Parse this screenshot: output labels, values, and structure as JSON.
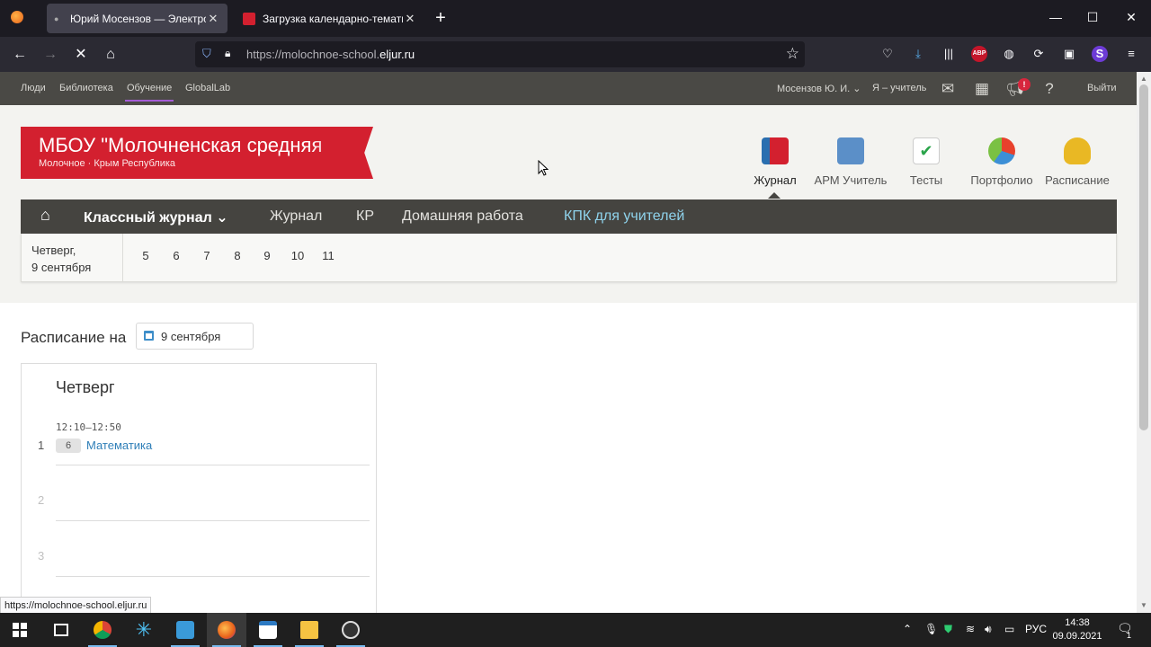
{
  "browser": {
    "tabs": [
      {
        "title": "Юрий Мосензов — Электронн",
        "active": true
      },
      {
        "title": "Загрузка календарно-тематич",
        "active": false
      }
    ],
    "new_tab": "+",
    "window_controls": {
      "minimize": "—",
      "maximize": "☐",
      "close": "✕"
    },
    "url_prefix": "https://molochnoe-school.",
    "url_domain": "eljur.ru",
    "status_url": "https://molochnoe-school.eljur.ru",
    "toolbar_icons": [
      "pocket-icon",
      "download-icon",
      "library-icon",
      "adblock-icon",
      "globe-icon",
      "sync-icon",
      "screenshot-icon",
      "extension-icon",
      "menu-icon"
    ],
    "adblock_label": "ABP"
  },
  "site": {
    "top_links": [
      "Люди",
      "Библиотека",
      "Обучение",
      "GlobalLab"
    ],
    "active_top_link": "Обучение",
    "user_name": "Мосензов Ю. И.",
    "role": "Я – учитель",
    "notification_count": "!",
    "logout": "Выйти",
    "school_name": "МБОУ \"Молочненская средняя",
    "school_place": "Молочное · Крым Республика",
    "modules": [
      {
        "label": "Журнал",
        "icon": "journal-icon",
        "active": true
      },
      {
        "label": "АРМ Учитель",
        "icon": "teacher-workplace-icon",
        "active": false
      },
      {
        "label": "Тесты",
        "icon": "tests-icon",
        "active": false
      },
      {
        "label": "Портфолио",
        "icon": "portfolio-icon",
        "active": false
      },
      {
        "label": "Расписание",
        "icon": "bell-icon",
        "active": false
      }
    ],
    "journal_nav": {
      "home": "⌂",
      "class_journal": "Классный журнал",
      "items": [
        "Журнал",
        "КР",
        "Домашняя работа",
        "КПК для учителей"
      ]
    },
    "day_line1": "Четверг,",
    "day_line2": "9 сентября",
    "lesson_numbers": [
      "5",
      "6",
      "7",
      "8",
      "9",
      "10",
      "11"
    ]
  },
  "schedule": {
    "label": "Расписание на",
    "date": "9 сентября",
    "weekday": "Четверг",
    "lessons": [
      {
        "index": "1",
        "time": "12:10–12:50",
        "class": "6",
        "subject": "Математика"
      },
      {
        "index": "2",
        "time": "",
        "class": "",
        "subject": ""
      },
      {
        "index": "3",
        "time": "",
        "class": "",
        "subject": ""
      }
    ]
  },
  "taskbar": {
    "lang": "РУС",
    "time": "14:38",
    "date": "09.09.2021",
    "notifications": "1"
  },
  "colors": {
    "ribbon": "#d3202f",
    "journal_nav": "#454440",
    "link": "#2f7fb8",
    "highlight_nav": "#8fd3ec"
  }
}
